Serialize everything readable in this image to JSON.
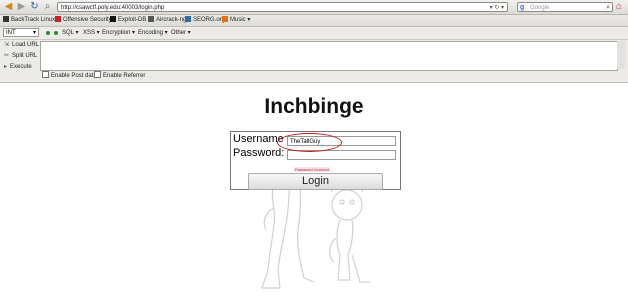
{
  "browser": {
    "url": "http://csawctf.poly.edu:40003/login.php",
    "search_engine": "Google",
    "search_placeholder": "Google"
  },
  "bookmarks": [
    {
      "label": "BackTrack Linux",
      "color": "#333"
    },
    {
      "label": "Offensive Security",
      "color": "#c22"
    },
    {
      "label": "Exploit-DB",
      "color": "#111"
    },
    {
      "label": "Aircrack-ng",
      "color": "#333"
    },
    {
      "label": "SEORG.org",
      "color": "#2a6fb0"
    },
    {
      "label": "Music ▾",
      "color": "#e0701a"
    }
  ],
  "hackbar": {
    "select_value": "INT",
    "menus": [
      "SQL ▾",
      "XSS ▾",
      "Encryption ▾",
      "Encoding ▾",
      "Other ▾"
    ],
    "actions": [
      "Load URL",
      "Split URL",
      "Execute"
    ],
    "checkboxes": [
      "Enable Post data",
      "Enable Referrer"
    ]
  },
  "page": {
    "title": "Inchbinge",
    "username_label": "Username",
    "password_label": "Password:",
    "username_value": "TheTallGuy",
    "password_value": "",
    "error": "Password incorrect",
    "login_label": "Login"
  },
  "colors": {
    "highlight": "#c81b1b",
    "error": "#c01f3a"
  }
}
